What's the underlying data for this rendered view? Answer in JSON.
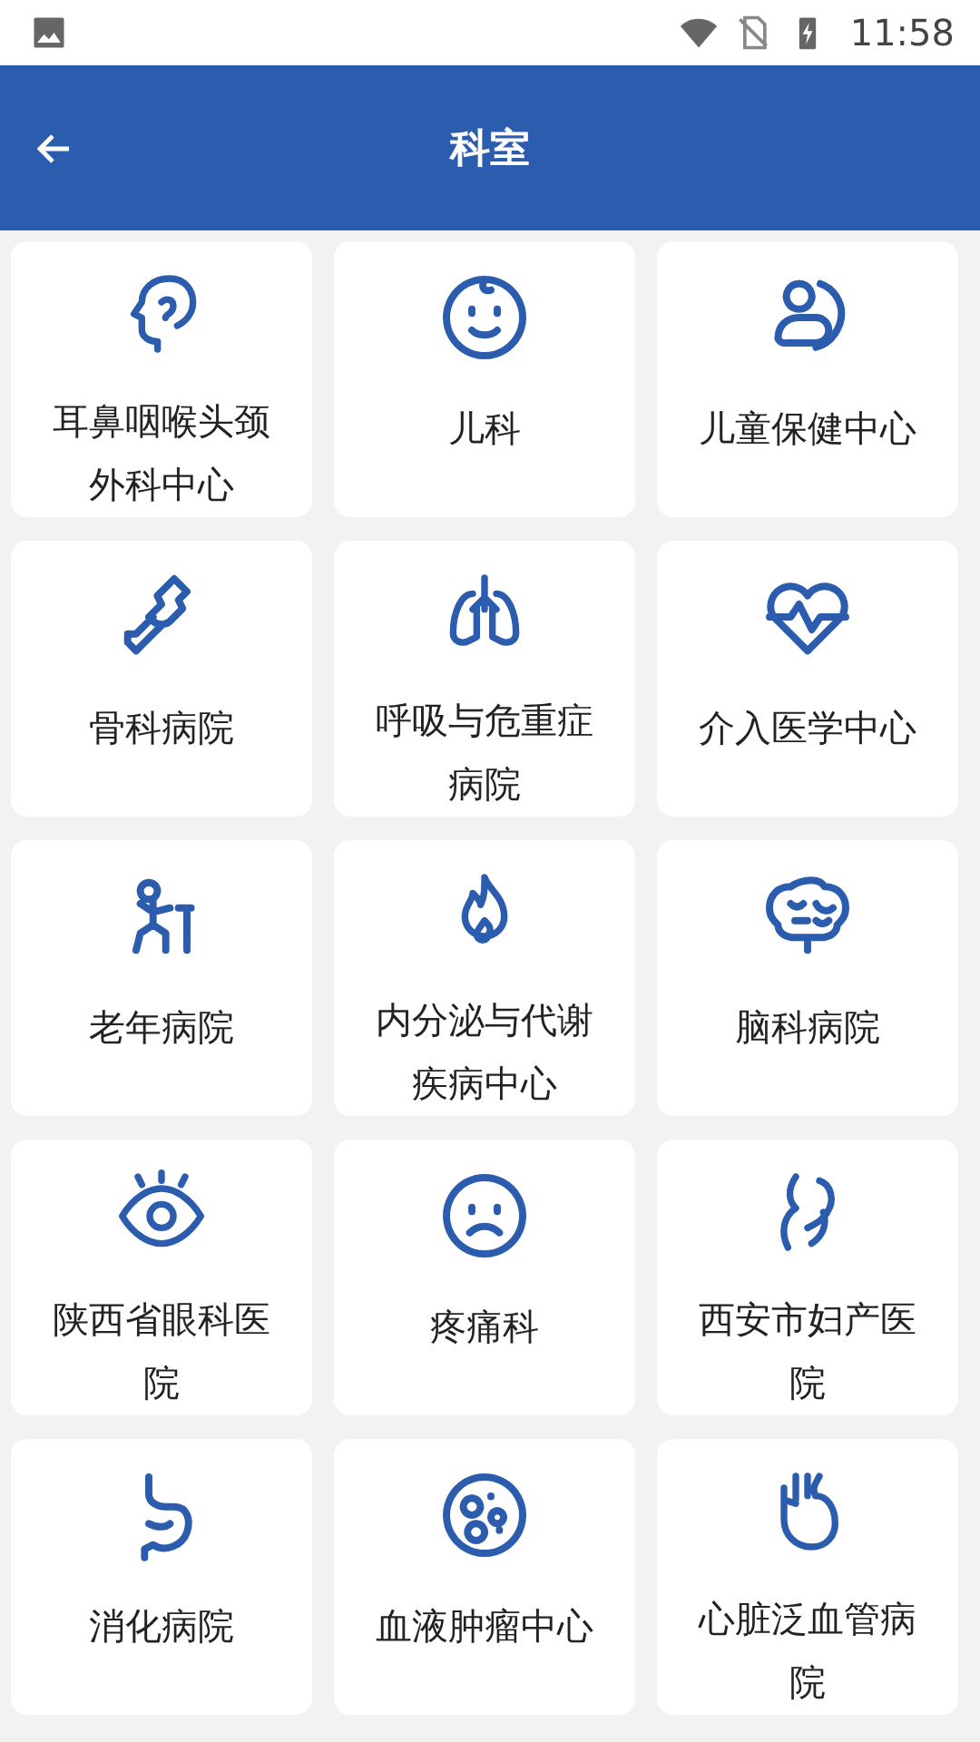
{
  "status_bar": {
    "time": "11:58"
  },
  "header": {
    "title": "科室"
  },
  "departments": [
    {
      "name": "耳鼻咽喉头颈外科中心"
    },
    {
      "name": "儿科"
    },
    {
      "name": "儿童保健中心"
    },
    {
      "name": "骨科病院"
    },
    {
      "name": "呼吸与危重症病院"
    },
    {
      "name": "介入医学中心"
    },
    {
      "name": "老年病院"
    },
    {
      "name": "内分泌与代谢疾病中心"
    },
    {
      "name": "脑科病院"
    },
    {
      "name": "陕西省眼科医院"
    },
    {
      "name": "疼痛科"
    },
    {
      "name": "西安市妇产医院"
    },
    {
      "name": "消化病院"
    },
    {
      "name": "血液肿瘤中心"
    },
    {
      "name": "心脏泛血管病院"
    }
  ]
}
